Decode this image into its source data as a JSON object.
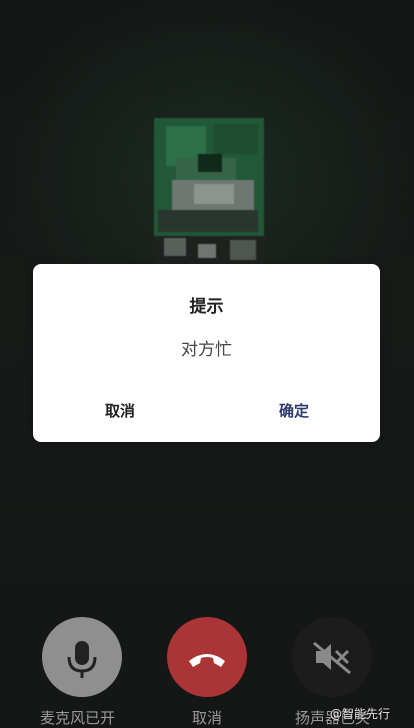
{
  "dialog": {
    "title": "提示",
    "message": "对方忙",
    "cancel_label": "取消",
    "confirm_label": "确定"
  },
  "controls": [
    {
      "label": "麦克风已开",
      "icon": "microphone-icon",
      "color": "#8f8f8f"
    },
    {
      "label": "取消",
      "icon": "phone-hangup-icon",
      "color": "#ab3536"
    },
    {
      "label": "扬声器已关",
      "icon": "speaker-muted-icon",
      "color": "#1b1c1b"
    }
  ],
  "watermark": "@智能先行",
  "colors": {
    "background": "#1e211f",
    "dialog_bg": "#ffffff",
    "confirm_text": "#2c3a6e",
    "hangup": "#ab3536"
  }
}
